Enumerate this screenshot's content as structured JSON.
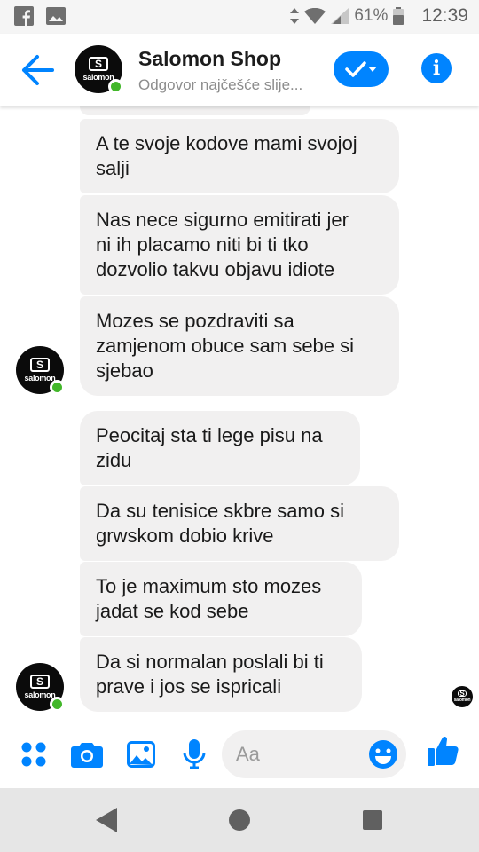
{
  "status_bar": {
    "battery_percent": "61%",
    "time": "12:39",
    "icons": [
      "facebook-icon",
      "gallery-icon",
      "data-arrows-icon",
      "wifi-icon",
      "signal-icon",
      "battery-icon"
    ]
  },
  "header": {
    "title": "Salomon Shop",
    "subtitle": "Odgovor najčešće slije...",
    "avatar_letter": "S",
    "avatar_brand": "salomon",
    "accent_color": "#0084ff",
    "online_color": "#42b72a"
  },
  "messages": [
    {
      "text": "A te svoje kodove mami svojoj\nsalji"
    },
    {
      "text": "Nas nece sigurno emitirati jer\nni ih placamo niti bi ti tko\ndozvolio takvu objavu idiote"
    },
    {
      "text": "Mozes se pozdraviti sa\nzamjenom obuce sam sebe si\nsjebao"
    },
    {
      "text": "Peocitaj sta ti lege pisu na\nzidu"
    },
    {
      "text": "Da su tenisice skbre samo si\ngrwskom dobio krive"
    },
    {
      "text": "To je maximum sto mozes\njadat se kod sebe"
    },
    {
      "text": "Da si normalan poslali bi ti\nprave i jos se ispricali"
    }
  ],
  "composer": {
    "placeholder": "Aa",
    "icons": [
      "more-apps-icon",
      "camera-icon",
      "gallery-icon",
      "microphone-icon",
      "emoji-icon",
      "thumbs-up-icon"
    ]
  },
  "nav": {
    "buttons": [
      "back-triangle-icon",
      "home-circle-icon",
      "recents-square-icon"
    ]
  }
}
